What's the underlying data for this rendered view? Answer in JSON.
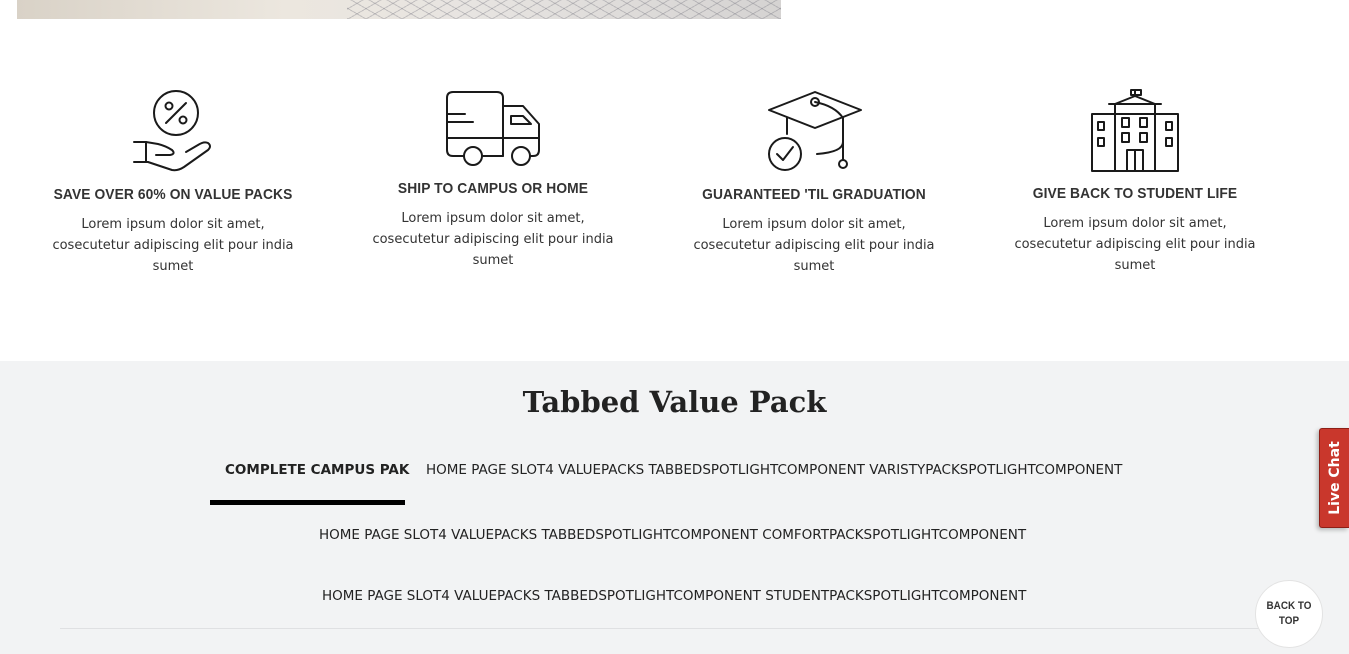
{
  "features": [
    {
      "icon": "discount-hand-icon",
      "title": "SAVE OVER 60% ON VALUE PACKS",
      "description": "Lorem ipsum dolor sit amet, cosecutetur adipiscing elit pour india sumet"
    },
    {
      "icon": "truck-icon",
      "title": "SHIP TO CAMPUS OR HOME",
      "description": "Lorem ipsum dolor sit amet, cosecutetur adipiscing elit pour india sumet"
    },
    {
      "icon": "graduation-cap-icon",
      "title": "GUARANTEED 'TIL GRADUATION",
      "description": "Lorem ipsum dolor sit amet, cosecutetur adipiscing elit pour india sumet"
    },
    {
      "icon": "school-building-icon",
      "title": "GIVE BACK TO STUDENT LIFE",
      "description": "Lorem ipsum dolor sit amet, cosecutetur adipiscing elit pour india sumet"
    }
  ],
  "tabbed": {
    "heading": "Tabbed Value Pack",
    "tabs": [
      {
        "label": "COMPLETE CAMPUS PAK",
        "active": true
      },
      {
        "label": "HOME PAGE SLOT4 VALUEPACKS TABBEDSPOTLIGHTCOMPONENT VARISTYPACKSPOTLIGHTCOMPONENT",
        "active": false
      },
      {
        "label": "HOME PAGE SLOT4 VALUEPACKS TABBEDSPOTLIGHTCOMPONENT COMFORTPACKSPOTLIGHTCOMPONENT",
        "active": false
      },
      {
        "label": "HOME PAGE SLOT4 VALUEPACKS TABBEDSPOTLIGHTCOMPONENT STUDENTPACKSPOTLIGHTCOMPONENT",
        "active": false
      }
    ]
  },
  "widgets": {
    "live_chat": "Live Chat",
    "back_to_top": "BACK TO TOP"
  },
  "colors": {
    "live_chat_bg": "#c9372c",
    "tab_active_underline": "#000000",
    "section_bg": "#f2f3f4"
  }
}
